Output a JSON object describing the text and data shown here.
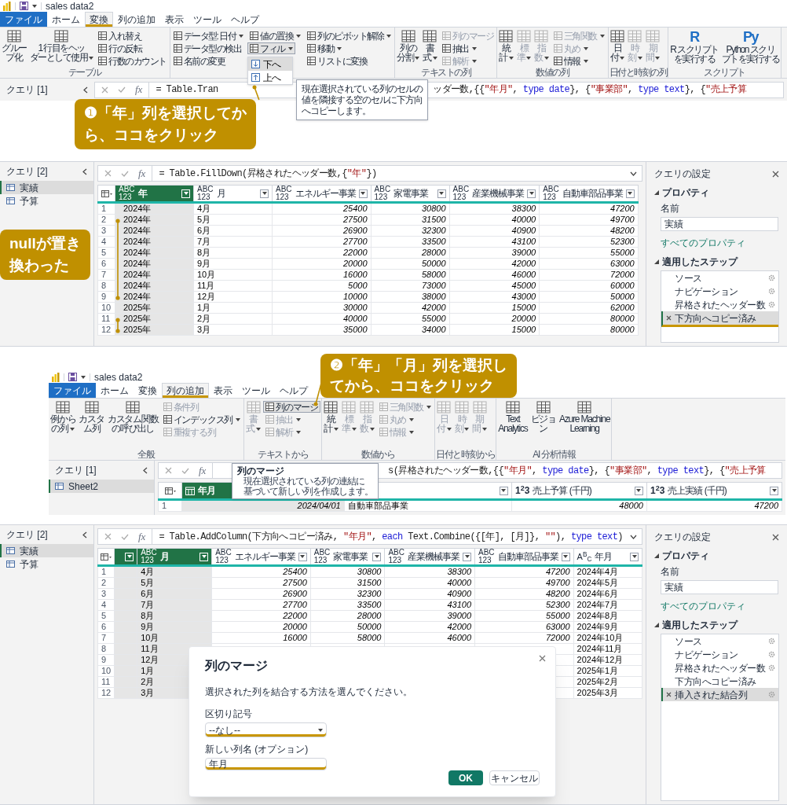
{
  "panel_1": {
    "title": "sales data2",
    "tabs": [
      {
        "label": "ファイル",
        "kind": "file",
        "selected": false
      },
      {
        "label": "ホーム",
        "kind": "tab",
        "selected": false
      },
      {
        "label": "変換",
        "kind": "tab",
        "selected": true
      },
      {
        "label": "列の追加",
        "kind": "tab",
        "selected": false
      },
      {
        "label": "表示",
        "kind": "tab",
        "selected": false
      },
      {
        "label": "ツール",
        "kind": "tab",
        "selected": false
      },
      {
        "label": "ヘルプ",
        "kind": "tab",
        "selected": false
      }
    ],
    "ribbon_groups": [
      {
        "label": "テーブル",
        "columns": [
          {
            "kind": "large",
            "lines": [
              "グルー",
              "プ化"
            ],
            "dropdown": false,
            "disabled": false
          },
          {
            "kind": "large",
            "lines": [
              "1 行目をヘッ",
              "ダーとして使用"
            ],
            "dropdown": true,
            "disabled": false
          },
          {
            "kind": "stack",
            "items": [
              {
                "label": "入れ替え",
                "dropdown": false,
                "disabled": false
              },
              {
                "label": "行の反転",
                "dropdown": false,
                "disabled": false
              },
              {
                "label": "行数のカウント",
                "dropdown": false,
                "disabled": false
              }
            ]
          }
        ]
      },
      {
        "columns": [
          {
            "kind": "stack",
            "items": [
              {
                "label": "データ型: 日付",
                "dropdown": true,
                "disabled": false
              },
              {
                "label": "データ型の検出",
                "dropdown": false,
                "disabled": false
              },
              {
                "label": "名前の変更",
                "dropdown": false,
                "disabled": false
              }
            ]
          },
          {
            "kind": "stack",
            "items": [
              {
                "label": "値の置換",
                "dropdown": true,
                "disabled": false
              },
              {
                "label": "フィル",
                "dropdown": true,
                "disabled": false,
                "hovered": true,
                "menu": [
                  {
                    "label": "下へ",
                    "selected": true
                  },
                  {
                    "label": "上へ",
                    "selected": false
                  }
                ]
              }
            ]
          },
          {
            "kind": "stack",
            "items": [
              {
                "label": "列のピボット解除",
                "dropdown": true,
                "disabled": false
              },
              {
                "label": "移動",
                "dropdown": true,
                "disabled": false
              },
              {
                "label": "リストに変換",
                "dropdown": false,
                "disabled": false
              }
            ]
          }
        ]
      },
      {
        "label": "テキストの列",
        "columns": [
          {
            "kind": "large",
            "lines": [
              "列の",
              "分割"
            ],
            "dropdown": true,
            "disabled": false
          },
          {
            "kind": "large",
            "lines": [
              "書",
              "式"
            ],
            "dropdown": true,
            "disabled": false
          },
          {
            "kind": "stack",
            "items": [
              {
                "label": "列のマージ",
                "dropdown": false,
                "disabled": true
              },
              {
                "label": "抽出",
                "dropdown": true,
                "disabled": false
              },
              {
                "label": "解析",
                "dropdown": true,
                "disabled": true
              }
            ]
          }
        ]
      },
      {
        "label": "数値の列",
        "columns": [
          {
            "kind": "large",
            "lines": [
              "統",
              "計"
            ],
            "dropdown": true,
            "disabled": false
          },
          {
            "kind": "large",
            "lines": [
              "標",
              "準"
            ],
            "dropdown": true,
            "disabled": true
          },
          {
            "kind": "large",
            "lines": [
              "指",
              "数"
            ],
            "dropdown": true,
            "disabled": true
          },
          {
            "kind": "stack",
            "items": [
              {
                "label": "三角関数",
                "dropdown": true,
                "disabled": true
              },
              {
                "label": "丸め",
                "dropdown": true,
                "disabled": true
              },
              {
                "label": "情報",
                "dropdown": true,
                "disabled": false
              }
            ]
          }
        ]
      },
      {
        "label": "日付と時刻の列",
        "columns": [
          {
            "kind": "large",
            "lines": [
              "日",
              "付"
            ],
            "dropdown": true,
            "disabled": false
          },
          {
            "kind": "large",
            "lines": [
              "時",
              "刻"
            ],
            "dropdown": true,
            "disabled": true
          },
          {
            "kind": "large",
            "lines": [
              "期",
              "間"
            ],
            "dropdown": true,
            "disabled": true
          }
        ]
      },
      {
        "label": "スクリプト",
        "columns": [
          {
            "kind": "large",
            "glyph": "R",
            "lines": [
              "R スクリプト",
              "を実行する"
            ],
            "dropdown": false,
            "disabled": false
          },
          {
            "kind": "large",
            "glyph": "Py",
            "lines": [
              "Python スクリ",
              "プトを実行する"
            ],
            "dropdown": false,
            "disabled": false
          }
        ]
      }
    ],
    "query": {
      "header": "クエリ [1]"
    },
    "formula": {
      "fx": "fx",
      "parts": [
        [
          {
            "text": "= Table.Tran",
            "kind": "plain"
          }
        ],
        [
          {
            "text": "ッダー数,{{",
            "kind": "plain"
          },
          {
            "text": "\"年月\"",
            "kind": "string"
          },
          {
            "text": ", ",
            "kind": "plain"
          },
          {
            "text": "type date",
            "kind": "keyword"
          },
          {
            "text": "}, {",
            "kind": "plain"
          },
          {
            "text": "\"事業部\"",
            "kind": "string"
          },
          {
            "text": ", ",
            "kind": "plain"
          },
          {
            "text": "type text",
            "kind": "keyword"
          },
          {
            "text": "}, {",
            "kind": "plain"
          },
          {
            "text": "\"売上予算",
            "kind": "string"
          }
        ]
      ]
    },
    "tooltip": {
      "lines": [
        "現在選択されている列のセルの",
        "値を隣接する空のセルに下方向",
        "へコピーします。"
      ]
    },
    "callout": [
      "❶「年」列を選択してか",
      "ら、ココをクリック"
    ]
  },
  "panel_2": {
    "query": {
      "header": "クエリ [2]",
      "items": [
        {
          "label": "実績",
          "selected": true
        },
        {
          "label": "予算",
          "selected": false
        }
      ]
    },
    "formula": {
      "fx": "fx",
      "parts": [
        [
          {
            "text": "= Table.FillDown(昇格されたヘッダー数,{",
            "kind": "plain"
          },
          {
            "text": "\"年\"",
            "kind": "string"
          },
          {
            "text": "})",
            "kind": "plain"
          }
        ]
      ]
    },
    "table": {
      "columns": [
        {
          "label": "年",
          "kind": "any",
          "type_mark": [
            "ABC",
            "123"
          ],
          "selected": true,
          "numeric": false
        },
        {
          "label": "月",
          "kind": "any",
          "type_mark": [
            "ABC",
            "123"
          ],
          "selected": false,
          "numeric": false
        },
        {
          "label": "エネルギー事業",
          "kind": "any",
          "type_mark": [
            "ABC",
            "123"
          ],
          "selected": false,
          "numeric": true
        },
        {
          "label": "家電事業",
          "kind": "any",
          "type_mark": [
            "ABC",
            "123"
          ],
          "selected": false,
          "numeric": true
        },
        {
          "label": "産業機械事業",
          "kind": "any",
          "type_mark": [
            "ABC",
            "123"
          ],
          "selected": false,
          "numeric": true
        },
        {
          "label": "自動車部品事業",
          "kind": "any",
          "type_mark": [
            "ABC",
            "123"
          ],
          "selected": false,
          "numeric": true
        }
      ],
      "rows": [
        {
          "number": "1",
          "cells": [
            "2024年",
            "4月",
            "25400",
            "30800",
            "38300",
            "47200"
          ]
        },
        {
          "number": "2",
          "cells": [
            "2024年",
            "5月",
            "27500",
            "31500",
            "40000",
            "49700"
          ]
        },
        {
          "number": "3",
          "cells": [
            "2024年",
            "6月",
            "26900",
            "32300",
            "40900",
            "48200"
          ]
        },
        {
          "number": "4",
          "cells": [
            "2024年",
            "7月",
            "27700",
            "33500",
            "43100",
            "52300"
          ]
        },
        {
          "number": "5",
          "cells": [
            "2024年",
            "8月",
            "22000",
            "28000",
            "39000",
            "55000"
          ]
        },
        {
          "number": "6",
          "cells": [
            "2024年",
            "9月",
            "20000",
            "50000",
            "42000",
            "63000"
          ]
        },
        {
          "number": "7",
          "cells": [
            "2024年",
            "10月",
            "16000",
            "58000",
            "46000",
            "72000"
          ]
        },
        {
          "number": "8",
          "cells": [
            "2024年",
            "11月",
            "5000",
            "73000",
            "45000",
            "60000"
          ]
        },
        {
          "number": "9",
          "cells": [
            "2024年",
            "12月",
            "10000",
            "38000",
            "43000",
            "50000"
          ]
        },
        {
          "number": "10",
          "cells": [
            "2025年",
            "1月",
            "30000",
            "42000",
            "15000",
            "62000"
          ]
        },
        {
          "number": "11",
          "cells": [
            "2025年",
            "2月",
            "40000",
            "55000",
            "20000",
            "80000"
          ]
        },
        {
          "number": "12",
          "cells": [
            "2025年",
            "3月",
            "35000",
            "34000",
            "15000",
            "80000"
          ]
        }
      ]
    },
    "settings": {
      "title": "クエリの設定",
      "properties_label": "プロパティ",
      "name_label": "名前",
      "name_value": "実績",
      "all_properties": "すべてのプロパティ",
      "steps_label": "適用したステップ",
      "steps": [
        {
          "label": "ソース",
          "selected": false,
          "settings_icon": true,
          "highlighted": false
        },
        {
          "label": "ナビゲーション",
          "selected": false,
          "settings_icon": true,
          "highlighted": false
        },
        {
          "label": "昇格されたヘッダー数",
          "selected": false,
          "settings_icon": true,
          "highlighted": false
        },
        {
          "label": "下方向へコピー済み",
          "selected": true,
          "settings_icon": false,
          "highlighted": true
        }
      ]
    },
    "callout": [
      "nullが置き",
      "換わった"
    ]
  },
  "panel_3": {
    "title": "sales data2",
    "tabs": [
      {
        "label": "ファイル",
        "kind": "file",
        "selected": false
      },
      {
        "label": "ホーム",
        "kind": "tab",
        "selected": false
      },
      {
        "label": "変換",
        "kind": "tab",
        "selected": false
      },
      {
        "label": "列の追加",
        "kind": "tab",
        "selected": true
      },
      {
        "label": "表示",
        "kind": "tab",
        "selected": false
      },
      {
        "label": "ツール",
        "kind": "tab",
        "selected": false
      },
      {
        "label": "ヘルプ",
        "kind": "tab",
        "selected": false
      }
    ],
    "ribbon_groups": [
      {
        "label": "全般",
        "columns": [
          {
            "kind": "large",
            "lines": [
              "例から",
              "の列"
            ],
            "dropdown": true,
            "disabled": false
          },
          {
            "kind": "large",
            "lines": [
              "カスタ",
              "ム列"
            ],
            "dropdown": false,
            "disabled": false
          },
          {
            "kind": "large",
            "lines": [
              "カスタム関数",
              "の呼び出し"
            ],
            "dropdown": false,
            "disabled": false
          },
          {
            "kind": "stack",
            "items": [
              {
                "label": "条件列",
                "dropdown": false,
                "disabled": true
              },
              {
                "label": "インデックス列",
                "dropdown": true,
                "disabled": false
              },
              {
                "label": "重複する列",
                "dropdown": false,
                "disabled": true
              }
            ]
          }
        ]
      },
      {
        "label": "テキストから",
        "columns": [
          {
            "kind": "large",
            "lines": [
              "書",
              "式"
            ],
            "dropdown": true,
            "disabled": true
          },
          {
            "kind": "stack",
            "items": [
              {
                "label": "列のマージ",
                "dropdown": false,
                "disabled": false,
                "hovered": true
              },
              {
                "label": "抽出",
                "dropdown": true,
                "disabled": true
              },
              {
                "label": "解析",
                "dropdown": true,
                "disabled": true
              }
            ]
          }
        ]
      },
      {
        "label": "数値から",
        "columns": [
          {
            "kind": "large",
            "lines": [
              "統",
              "計"
            ],
            "dropdown": true,
            "disabled": false
          },
          {
            "kind": "large",
            "lines": [
              "標",
              "準"
            ],
            "dropdown": true,
            "disabled": true
          },
          {
            "kind": "large",
            "lines": [
              "指",
              "数"
            ],
            "dropdown": true,
            "disabled": true
          },
          {
            "kind": "stack",
            "items": [
              {
                "label": "三角関数",
                "dropdown": true,
                "disabled": true
              },
              {
                "label": "丸め",
                "dropdown": true,
                "disabled": true
              },
              {
                "label": "情報",
                "dropdown": true,
                "disabled": true
              }
            ]
          }
        ]
      },
      {
        "label": "日付と時刻から",
        "columns": [
          {
            "kind": "large",
            "lines": [
              "日",
              "付"
            ],
            "dropdown": true,
            "disabled": true
          },
          {
            "kind": "large",
            "lines": [
              "時",
              "刻"
            ],
            "dropdown": true,
            "disabled": true
          },
          {
            "kind": "large",
            "lines": [
              "期",
              "間"
            ],
            "dropdown": true,
            "disabled": true
          }
        ]
      },
      {
        "label": "AI 分析情報",
        "columns": [
          {
            "kind": "large",
            "lines": [
              "Text",
              "Analytics"
            ],
            "dropdown": false,
            "disabled": false
          },
          {
            "kind": "large",
            "lines": [
              "ビジョ",
              "ン"
            ],
            "dropdown": false,
            "disabled": false
          },
          {
            "kind": "large",
            "lines": [
              "Azure Machine",
              "Learning"
            ],
            "dropdown": false,
            "disabled": false
          }
        ]
      }
    ],
    "query": {
      "header": "クエリ [1]",
      "items": [
        {
          "label": "Sheet2",
          "selected": true
        }
      ]
    },
    "formula": {
      "fx": "fx",
      "covered_start": true,
      "parts": [
        [
          {
            "text": "s(昇格されたヘッダー数,{{",
            "kind": "plain"
          },
          {
            "text": "\"年月\"",
            "kind": "string"
          },
          {
            "text": ", ",
            "kind": "plain"
          },
          {
            "text": "type date",
            "kind": "keyword"
          },
          {
            "text": "}, {",
            "kind": "plain"
          },
          {
            "text": "\"事業部\"",
            "kind": "string"
          },
          {
            "text": ", ",
            "kind": "plain"
          },
          {
            "text": "type text",
            "kind": "keyword"
          },
          {
            "text": "}, {",
            "kind": "plain"
          },
          {
            "text": "\"売上予算",
            "kind": "string"
          }
        ]
      ]
    },
    "table": {
      "columns": [
        {
          "label": "年月",
          "kind": "date",
          "selected": true,
          "numeric": true
        },
        {
          "kind": "any",
          "selected": false,
          "numeric": false
        },
        {
          "label": "売上予算 (千円)",
          "kind": "number",
          "type_mark": [
            "1$^{2}$3"
          ],
          "selected": false,
          "numeric": true
        },
        {
          "label": "売上実績 (千円)",
          "kind": "number",
          "type_mark": [
            "1$^{2}$3"
          ],
          "selected": false,
          "numeric": true
        }
      ],
      "rows": [
        {
          "number": "1",
          "cells": [
            "2024/04/01",
            "自動車部品事業",
            "48000",
            "47200"
          ]
        }
      ]
    },
    "tooltip": {
      "title": "列のマージ",
      "lines": [
        "現在選択されている列の連結に",
        "基づいて新しい列を作成します。"
      ]
    },
    "callout": [
      "❷「年」「月」列を選択し",
      "てから、ココをクリック"
    ]
  },
  "panel_4": {
    "query": {
      "header": "クエリ [2]",
      "items": [
        {
          "label": "実績",
          "selected": true
        },
        {
          "label": "予算",
          "selected": false
        }
      ]
    },
    "formula": {
      "fx": "fx",
      "parts": [
        [
          {
            "text": "= Table.AddColumn(下方向へコピー済み, ",
            "kind": "plain"
          },
          {
            "text": "\"年月\"",
            "kind": "string"
          },
          {
            "text": ", ",
            "kind": "plain"
          },
          {
            "text": "each",
            "kind": "keyword"
          },
          {
            "text": " Text.Combine({[年], [月]}, ",
            "kind": "plain"
          },
          {
            "text": "\"\"",
            "kind": "string"
          },
          {
            "text": "), ",
            "kind": "plain"
          },
          {
            "text": "type text",
            "kind": "keyword"
          },
          {
            "text": ")",
            "kind": "plain"
          }
        ]
      ]
    },
    "table": {
      "columns": [
        {
          "kind": "any",
          "selected": true
        },
        {
          "label": "月",
          "kind": "any",
          "type_mark": [
            "ABC",
            "123"
          ],
          "selected": true,
          "numeric": false
        },
        {
          "label": "エネルギー事業",
          "kind": "any",
          "type_mark": [
            "ABC",
            "123"
          ],
          "selected": false,
          "numeric": true
        },
        {
          "label": "家電事業",
          "kind": "any",
          "type_mark": [
            "ABC",
            "123"
          ],
          "selected": false,
          "numeric": true
        },
        {
          "label": "産業機械事業",
          "kind": "any",
          "type_mark": [
            "ABC",
            "123"
          ],
          "selected": false,
          "numeric": true
        },
        {
          "label": "自動車部品事業",
          "kind": "any",
          "type_mark": [
            "ABC",
            "123"
          ],
          "selected": false,
          "numeric": true
        },
        {
          "label": "年月",
          "kind": "text",
          "type_mark": [
            "A$^{B}$$_{C}$"
          ],
          "selected": false,
          "numeric": false
        }
      ],
      "rows": [
        {
          "number": "1",
          "cells": [
            null,
            "4月",
            "25400",
            "30800",
            "38300",
            "47200",
            "2024年4月"
          ]
        },
        {
          "number": "2",
          "cells": [
            null,
            "5月",
            "27500",
            "31500",
            "40000",
            "49700",
            "2024年5月"
          ]
        },
        {
          "number": "3",
          "cells": [
            null,
            "6月",
            "26900",
            "32300",
            "40900",
            "48200",
            "2024年6月"
          ]
        },
        {
          "number": "4",
          "cells": [
            null,
            "7月",
            "27700",
            "33500",
            "43100",
            "52300",
            "2024年7月"
          ]
        },
        {
          "number": "5",
          "cells": [
            null,
            "8月",
            "22000",
            "28000",
            "39000",
            "55000",
            "2024年8月"
          ]
        },
        {
          "number": "6",
          "cells": [
            null,
            "9月",
            "20000",
            "50000",
            "42000",
            "63000",
            "2024年9月"
          ]
        },
        {
          "number": "7",
          "cells": [
            null,
            "10月",
            "16000",
            "58000",
            "46000",
            "72000",
            "2024年10月"
          ]
        },
        {
          "number": "8",
          "cells": [
            null,
            "11月",
            null,
            null,
            null,
            null,
            "2024年11月"
          ]
        },
        {
          "number": "9",
          "cells": [
            null,
            "12月",
            null,
            null,
            null,
            null,
            "2024年12月"
          ]
        },
        {
          "number": "10",
          "cells": [
            null,
            "1月",
            null,
            null,
            null,
            null,
            "2025年1月"
          ]
        },
        {
          "number": "11",
          "cells": [
            null,
            "2月",
            null,
            null,
            null,
            null,
            "2025年2月"
          ]
        },
        {
          "number": "12",
          "cells": [
            null,
            "3月",
            null,
            null,
            null,
            null,
            "2025年3月"
          ]
        }
      ]
    },
    "settings": {
      "title": "クエリの設定",
      "properties_label": "プロパティ",
      "name_label": "名前",
      "name_value": "実績",
      "all_properties": "すべてのプロパティ",
      "steps_label": "適用したステップ",
      "steps": [
        {
          "label": "ソース",
          "selected": false,
          "settings_icon": true,
          "highlighted": false
        },
        {
          "label": "ナビゲーション",
          "selected": false,
          "settings_icon": true,
          "highlighted": false
        },
        {
          "label": "昇格されたヘッダー数",
          "selected": false,
          "settings_icon": true,
          "highlighted": false
        },
        {
          "label": "下方向へコピー済み",
          "selected": false,
          "settings_icon": false,
          "highlighted": false
        },
        {
          "label": "挿入された結合列",
          "selected": true,
          "settings_icon": true,
          "highlighted": false
        }
      ]
    },
    "dialog": {
      "title": "列のマージ",
      "description": "選択された列を結合する方法を選んでください。",
      "separator_label": "区切り記号",
      "separator_value": "--なし--",
      "separator_highlighted": true,
      "name_label": "新しい列名 (オプション)",
      "name_value": "年月",
      "name_highlighted": true,
      "ok": "OK",
      "cancel": "キャンセル"
    }
  }
}
